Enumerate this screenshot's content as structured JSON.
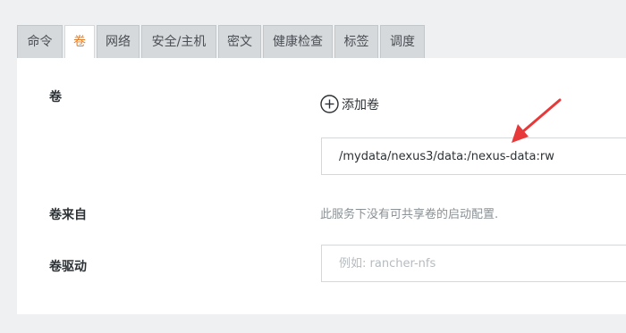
{
  "tabs": [
    {
      "label": "命令",
      "active": false
    },
    {
      "label": "卷",
      "active": true
    },
    {
      "label": "网络",
      "active": false
    },
    {
      "label": "安全/主机",
      "active": false
    },
    {
      "label": "密文",
      "active": false
    },
    {
      "label": "健康检查",
      "active": false
    },
    {
      "label": "标签",
      "active": false
    },
    {
      "label": "调度",
      "active": false
    }
  ],
  "volumes": {
    "label": "卷",
    "add_label": "添加卷",
    "value": "/mydata/nexus3/data:/nexus-data:rw"
  },
  "volumes_from": {
    "label": "卷来自",
    "hint": "此服务下没有可共享卷的启动配置."
  },
  "volume_driver": {
    "label": "卷驱动",
    "placeholder": "例如: rancher-nfs",
    "value": ""
  },
  "colors": {
    "active_tab_text": "#e07b27",
    "annotation_arrow": "#e8393a"
  }
}
